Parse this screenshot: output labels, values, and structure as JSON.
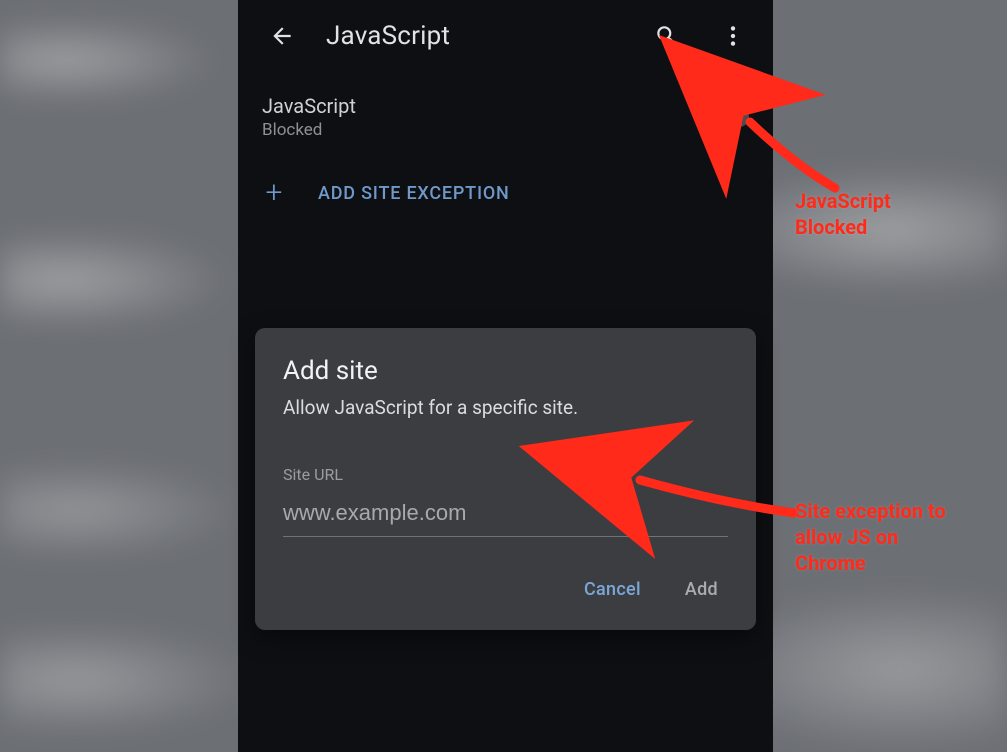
{
  "appbar": {
    "title": "JavaScript"
  },
  "setting": {
    "label": "JavaScript",
    "status": "Blocked",
    "toggle_on": false
  },
  "add_exception": {
    "label": "ADD SITE EXCEPTION"
  },
  "dialog": {
    "title": "Add site",
    "subtitle": "Allow JavaScript for a specific site.",
    "field_label": "Site URL",
    "placeholder": "www.example.com",
    "value": "",
    "cancel_label": "Cancel",
    "add_label": "Add"
  },
  "annotations": {
    "js_blocked": "JavaScript\nBlocked",
    "site_exception": "Site exception to\nallow JS on\nChrome"
  }
}
